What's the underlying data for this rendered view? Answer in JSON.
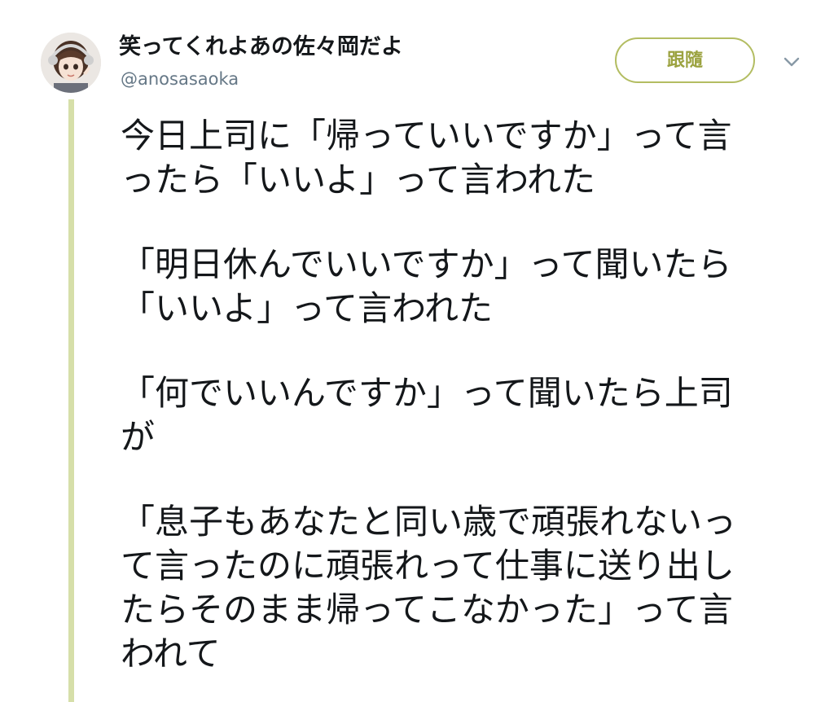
{
  "user": {
    "display_name": "笑ってくれよあの佐々岡だよ",
    "handle": "@anosasaoka",
    "avatar_icon": "anime-girl-avatar-icon"
  },
  "actions": {
    "follow_label": "跟隨",
    "more_icon": "chevron-down-icon"
  },
  "tweet": {
    "paragraphs": [
      [
        "今日上司に「帰っていいですか」って言",
        "ったら「いいよ」って言われた"
      ],
      [
        "「明日休んでいいですか」って聞いたら",
        "「いいよ」って言われた"
      ],
      [
        "「何でいいんですか」って聞いたら上司",
        "が"
      ],
      [
        "「息子もあなたと同い歳で頑張れないっ",
        "て言ったのに頑張れって仕事に送り出し",
        "たらそのまま帰ってこなかった」って言",
        "われて"
      ]
    ]
  },
  "colors": {
    "accent": "#b3bd62",
    "thread_line": "#d6dfa9",
    "secondary_text": "#657786"
  }
}
